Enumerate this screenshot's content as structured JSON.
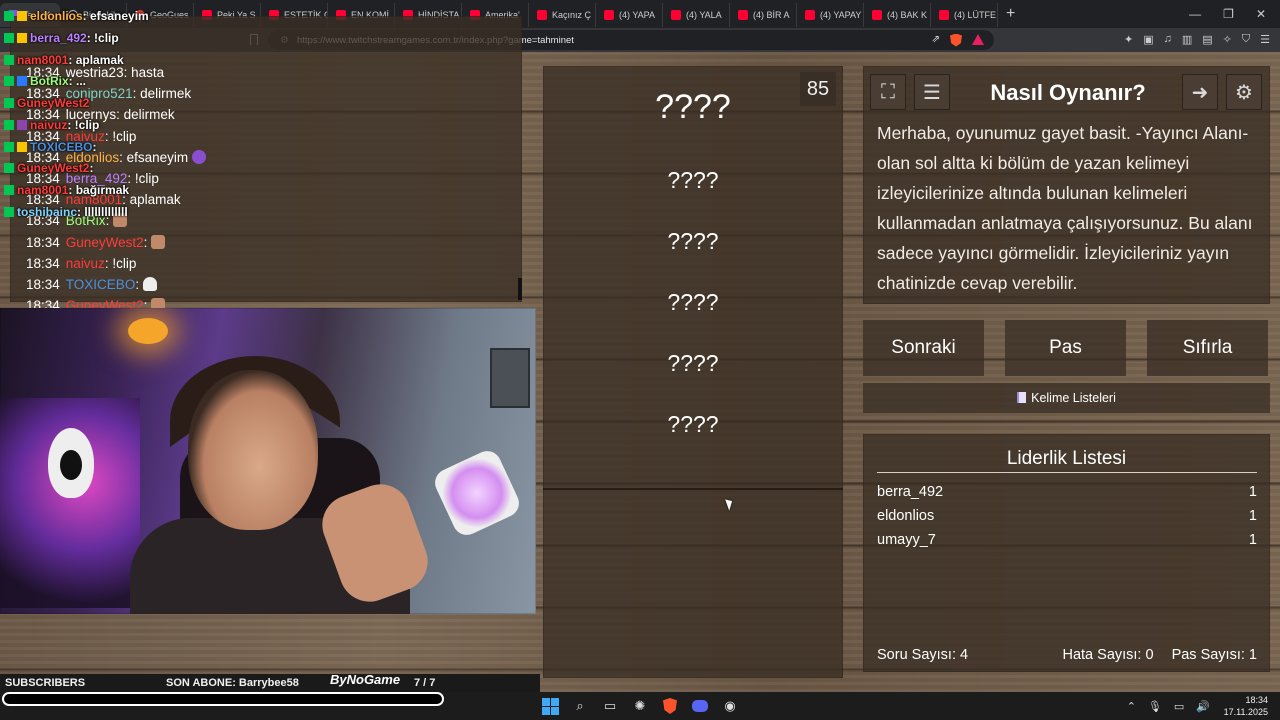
{
  "browser": {
    "tabs": [
      {
        "label": "Ta",
        "icon": "twitch-icon",
        "active": true
      },
      {
        "label": "Bir dakik",
        "icon": "globe-icon"
      },
      {
        "label": "GeoGues",
        "icon": "geoguessr-icon"
      },
      {
        "label": "Peki Ya S",
        "icon": "youtube-icon"
      },
      {
        "label": "ESTETİK C",
        "icon": "youtube-icon"
      },
      {
        "label": "EN KOMİ",
        "icon": "youtube-icon"
      },
      {
        "label": "HİNDİSTA",
        "icon": "youtube-icon"
      },
      {
        "label": "Amerika'",
        "icon": "youtube-icon"
      },
      {
        "label": "Kaçınız Ç",
        "icon": "youtube-icon"
      },
      {
        "label": "(4) YAPA",
        "icon": "youtube-icon"
      },
      {
        "label": "(4) YALA",
        "icon": "youtube-icon"
      },
      {
        "label": "(4) BİR A",
        "icon": "youtube-icon"
      },
      {
        "label": "(4) YAPAY",
        "icon": "youtube-icon"
      },
      {
        "label": "(4) BAK K",
        "icon": "youtube-icon"
      },
      {
        "label": "(4) LÜTFE",
        "icon": "youtube-icon"
      }
    ],
    "new_tab": "+",
    "url": "https://www.twitchstreamgames.com.tr/index.php?game=tahminet"
  },
  "overlay_chat": [
    {
      "user": "eldonlios",
      "text": ": efsaneyim",
      "color": "#ffb347"
    },
    {
      "user": "berra_492",
      "text": ": !clip",
      "color": "#b980ff"
    },
    {
      "user": "nam8001",
      "text": ": aplamak",
      "color": "#ff3b3b"
    },
    {
      "user": "BotRix",
      "text": ": ...",
      "color": "#9aff7a"
    },
    {
      "user": "GuneyWest2",
      "text": "",
      "color": "#ff3b3b"
    },
    {
      "user": "naivuz",
      "text": ": !clip",
      "color": "#ff3b3b"
    },
    {
      "user": "TOXICEBO",
      "text": ":",
      "color": "#4a90e2"
    },
    {
      "user": "GuneyWest2",
      "text": ":",
      "color": "#ff3b3b"
    },
    {
      "user": "nam8001",
      "text": ": bağırmak",
      "color": "#ff3b3b"
    },
    {
      "user": "toshibainc",
      "text": ": lllllllllllll",
      "color": "#7fd3ff"
    }
  ],
  "chat": [
    {
      "time": "18:34",
      "user": "westria23",
      "text": ": hasta",
      "color": "#ffffff"
    },
    {
      "time": "18:34",
      "user": "conipro521",
      "text": ": delirmek",
      "color": "#7fd3c8"
    },
    {
      "time": "18:34",
      "user": "lucernys",
      "text": ": delirmek",
      "color": "#ffffff"
    },
    {
      "time": "18:34",
      "user": "naivuz",
      "text": ": !clip",
      "color": "#ff3b3b"
    },
    {
      "time": "18:34",
      "user": "eldonlios",
      "text": ": efsaneyim",
      "color": "#ffb347"
    },
    {
      "time": "18:34",
      "user": "berra_492",
      "text": ": !clip",
      "color": "#b980ff"
    },
    {
      "time": "18:34",
      "user": "nam8001",
      "text": ": aplamak",
      "color": "#ff3b3b"
    },
    {
      "time": "18:34",
      "user": "BotRix",
      "text": ":",
      "color": "#9aff7a"
    },
    {
      "time": "18:34",
      "user": "GuneyWest2",
      "text": ":",
      "color": "#ff3b3b"
    },
    {
      "time": "18:34",
      "user": "naivuz",
      "text": ": !clip",
      "color": "#ff3b3b"
    },
    {
      "time": "18:34",
      "user": "TOXICEBO",
      "text": ":",
      "color": "#4a90e2"
    },
    {
      "time": "18:34",
      "user": "GuneyWest2",
      "text": ":",
      "color": "#ff3b3b"
    },
    {
      "time": "18:34",
      "user": "nam8001",
      "text": ": bağırmak",
      "color": "#ff3b3b"
    },
    {
      "time": "18:34",
      "user": "toshibainc",
      "text": ": lilillilllilli",
      "color": "#7fd3ff"
    }
  ],
  "game": {
    "counter": "85",
    "main_word": "????",
    "forbidden_words": [
      "????",
      "????",
      "????",
      "????",
      "????"
    ],
    "how_to_title": "Nasıl Oynanır?",
    "how_to_text": "Merhaba, oyunumuz gayet basit. -Yayıncı Alanı- olan sol altta ki bölüm de yazan kelimeyi izleyicilerinize altında bulunan kelimeleri kullanmadan anlatmaya çalışıyorsunuz. Bu alanı sadece yayıncı görmelidir. İzleyicileriniz yayın chatinizde cevap verebilir.",
    "buttons": {
      "next": "Sonraki",
      "pass": "Pas",
      "reset": "Sıfırla"
    },
    "word_lists_label": "Kelime Listeleri",
    "leaderboard": {
      "title": "Liderlik Listesi",
      "rows": [
        {
          "name": "berra_492",
          "score": "1"
        },
        {
          "name": "eldonlios",
          "score": "1"
        },
        {
          "name": "umayy_7",
          "score": "1"
        }
      ]
    },
    "stats": {
      "questions": "Soru Sayısı: 4",
      "errors": "Hata Sayısı: 0",
      "passes": "Pas Sayısı: 1"
    }
  },
  "stream_bar": {
    "subscribers_label": "SUBSCRIBERS",
    "last_sub": "SON ABONE: Barrybee58",
    "brand": "ByNoGame",
    "goal": "7 / 7"
  },
  "taskbar": {
    "time": "18:34",
    "date": "17.11.2025",
    "discord_badge": "99+"
  }
}
